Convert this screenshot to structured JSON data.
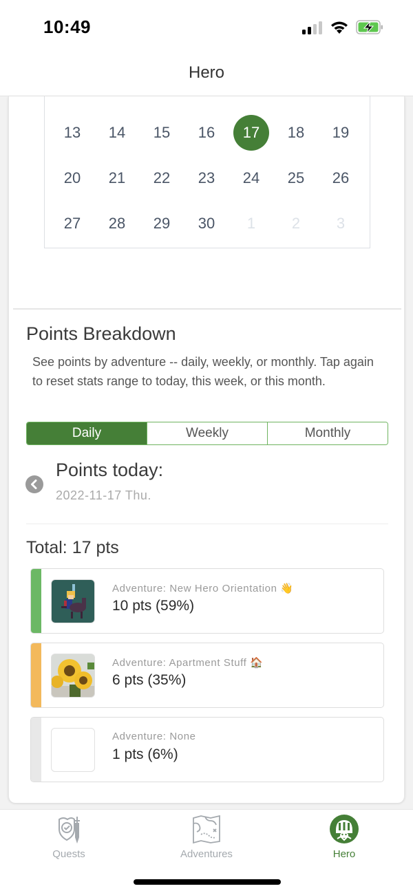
{
  "status_bar": {
    "time": "10:49",
    "signal_icon": "cellular-signal-icon",
    "wifi_icon": "wifi-icon",
    "battery_icon": "battery-charging-icon"
  },
  "header": {
    "title": "Hero"
  },
  "calendar": {
    "selected_day": "17",
    "rows": [
      [
        {
          "day": "13",
          "muted": false
        },
        {
          "day": "14",
          "muted": false
        },
        {
          "day": "15",
          "muted": false
        },
        {
          "day": "16",
          "muted": false
        },
        {
          "day": "17",
          "muted": false,
          "selected": true
        },
        {
          "day": "18",
          "muted": false
        },
        {
          "day": "19",
          "muted": false
        }
      ],
      [
        {
          "day": "20",
          "muted": false
        },
        {
          "day": "21",
          "muted": false
        },
        {
          "day": "22",
          "muted": false
        },
        {
          "day": "23",
          "muted": false
        },
        {
          "day": "24",
          "muted": false
        },
        {
          "day": "25",
          "muted": false
        },
        {
          "day": "26",
          "muted": false
        }
      ],
      [
        {
          "day": "27",
          "muted": false
        },
        {
          "day": "28",
          "muted": false
        },
        {
          "day": "29",
          "muted": false
        },
        {
          "day": "30",
          "muted": false
        },
        {
          "day": "1",
          "muted": true
        },
        {
          "day": "2",
          "muted": true
        },
        {
          "day": "3",
          "muted": true
        }
      ]
    ]
  },
  "breakdown": {
    "title": "Points Breakdown",
    "description": "See points by adventure -- daily, weekly, or monthly. Tap again to reset stats range to today, this week, or this month.",
    "segments": [
      {
        "label": "Daily",
        "active": true
      },
      {
        "label": "Weekly",
        "active": false
      },
      {
        "label": "Monthly",
        "active": false
      }
    ],
    "points_title": "Points today:",
    "date": "2022-11-17 Thu.",
    "back_icon": "chevron-left-circle-icon",
    "total": "Total: 17 pts",
    "adventures": [
      {
        "name": "Adventure: New Hero Orientation 👋",
        "points": "10 pts (59%)",
        "accent": "#6cb865",
        "thumb": "hero-knight-image"
      },
      {
        "name": "Adventure: Apartment Stuff 🏠",
        "points": "6 pts (35%)",
        "accent": "#f3b95c",
        "thumb": "sunflowers-image"
      },
      {
        "name": "Adventure: None",
        "points": "1 pts (6%)",
        "accent": "#e8e8e8",
        "thumb": "empty-image"
      }
    ]
  },
  "tab_bar": {
    "tabs": [
      {
        "label": "Quests",
        "icon": "shield-sword-icon",
        "active": false
      },
      {
        "label": "Adventures",
        "icon": "treasure-map-icon",
        "active": false
      },
      {
        "label": "Hero",
        "icon": "knight-helmet-icon",
        "active": true
      }
    ]
  },
  "colors": {
    "accent_green": "#457f37",
    "border_green": "#6eb35f",
    "inactive_tab": "#a4a9ae"
  }
}
